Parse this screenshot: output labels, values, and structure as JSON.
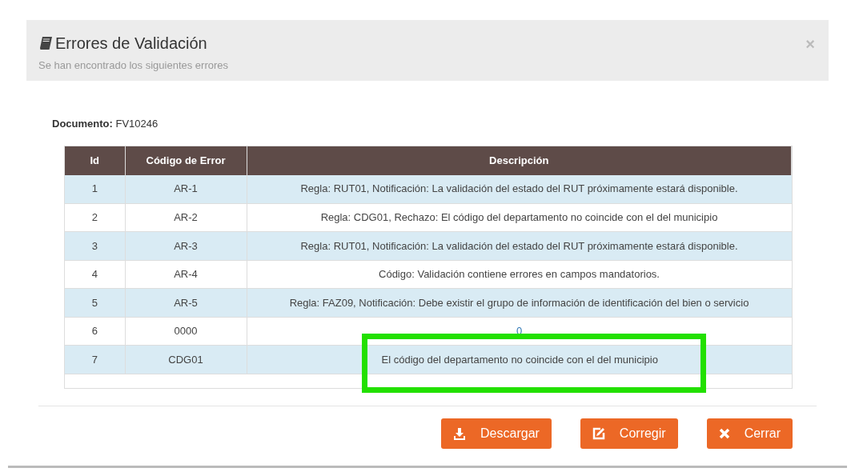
{
  "dialog": {
    "title": "Errores de Validación",
    "subtitle": "Se han encontrado los siguientes errores",
    "close": "×"
  },
  "document": {
    "label": "Documento:",
    "value": "FV10246"
  },
  "table": {
    "columns": [
      "Id",
      "Código de Error",
      "Descripción"
    ],
    "rows": [
      {
        "id": "1",
        "code": "AR-1",
        "description": "Regla: RUT01, Notificación: La validación del estado del RUT próximamente estará disponible.",
        "kind": "text",
        "highlighted": false
      },
      {
        "id": "2",
        "code": "AR-2",
        "description": "Regla: CDG01, Rechazo: El código del departamento no coincide con el del municipio",
        "kind": "text",
        "highlighted": false
      },
      {
        "id": "3",
        "code": "AR-3",
        "description": "Regla: RUT01, Notificación: La validación del estado del RUT próximamente estará disponible.",
        "kind": "text",
        "highlighted": false
      },
      {
        "id": "4",
        "code": "AR-4",
        "description": "Código: Validación contiene errores en campos mandatorios.",
        "kind": "text",
        "highlighted": false
      },
      {
        "id": "5",
        "code": "AR-5",
        "description": "Regla: FAZ09, Notificación: Debe existir el grupo de información de identificación del bien o servicio",
        "kind": "text",
        "highlighted": false
      },
      {
        "id": "6",
        "code": "0000",
        "description": "0",
        "kind": "link",
        "highlighted": false
      },
      {
        "id": "7",
        "code": "CDG01",
        "description": "El código del departamento no coincide con el del municipio",
        "kind": "text",
        "highlighted": true
      }
    ]
  },
  "buttons": [
    {
      "label": "Descargar"
    },
    {
      "label": "Corregir"
    },
    {
      "label": "Cerrar"
    }
  ]
}
